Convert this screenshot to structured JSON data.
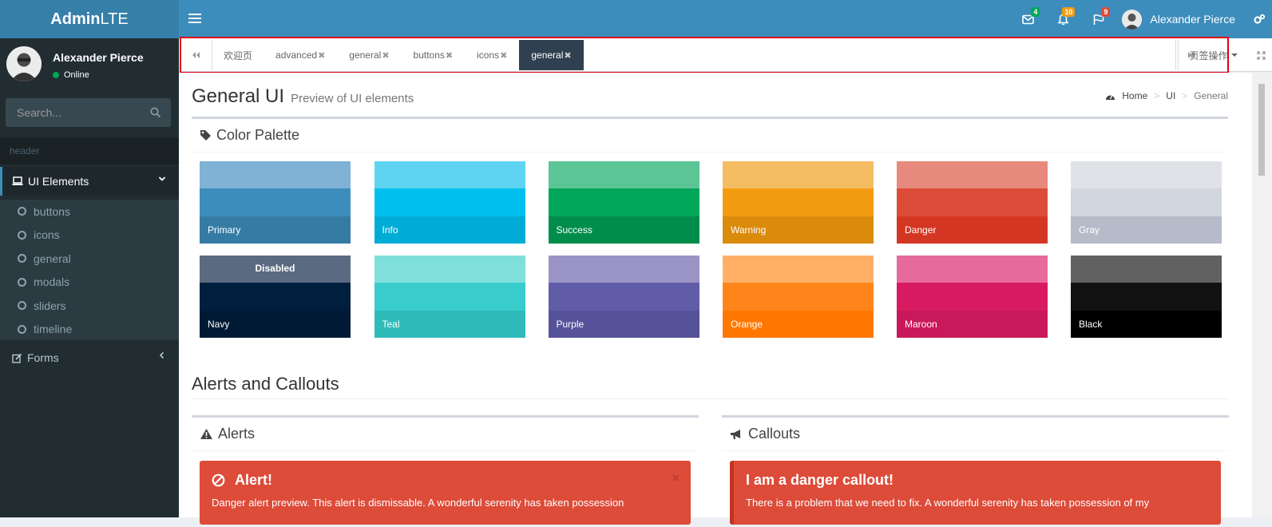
{
  "header": {
    "logo_bold": "Admin",
    "logo_rest": "LTE",
    "messages_count": "4",
    "notifications_count": "10",
    "tasks_count": "9",
    "user_name": "Alexander Pierce",
    "colors": {
      "header_bg": "#3c8dbc",
      "logo_bg": "#367fa9",
      "badge_green": "#00a65a",
      "badge_yellow": "#f39c12",
      "badge_red": "#dd4b39"
    }
  },
  "sidebar": {
    "user_name": "Alexander Pierce",
    "user_status": "Online",
    "search_placeholder": "Search...",
    "section_header": "header",
    "ui_elements_label": "UI Elements",
    "sub_items": [
      "buttons",
      "icons",
      "general",
      "modals",
      "sliders",
      "timeline"
    ],
    "forms_label": "Forms"
  },
  "tabbar": {
    "tabs": [
      {
        "label": "欢迎页",
        "closable": false
      },
      {
        "label": "advanced",
        "closable": true
      },
      {
        "label": "general",
        "closable": true
      },
      {
        "label": "buttons",
        "closable": true
      },
      {
        "label": "icons",
        "closable": true
      },
      {
        "label": "general",
        "closable": true,
        "active": true
      }
    ],
    "close_glyph": "✖",
    "ops_label": "页签操作"
  },
  "content": {
    "title": "General UI",
    "subtitle": "Preview of UI elements",
    "breadcrumb": {
      "home": "Home",
      "ui": "UI",
      "current": "General",
      "separator": ">"
    },
    "palette_title": "Color Palette",
    "palette": [
      {
        "name": "Primary",
        "colors": [
          "#7fb2d4",
          "#3c8dbc",
          "#357ca5"
        ]
      },
      {
        "name": "Info",
        "colors": [
          "#5fd4f2",
          "#00c0ef",
          "#00acd6"
        ]
      },
      {
        "name": "Success",
        "colors": [
          "#5bc595",
          "#00a65a",
          "#008d4c"
        ]
      },
      {
        "name": "Warning",
        "colors": [
          "#f5bd63",
          "#f39c12",
          "#db8b0b"
        ]
      },
      {
        "name": "Danger",
        "colors": [
          "#e7897d",
          "#dd4b39",
          "#d33724"
        ]
      },
      {
        "name": "Gray",
        "colors": [
          "#e0e2e7",
          "#d2d6de",
          "#b5bbc8"
        ]
      },
      {
        "name": "Navy",
        "colors": [
          "#5a6a80",
          "#001f3f",
          "#001a35"
        ],
        "disabled_label": "Disabled"
      },
      {
        "name": "Teal",
        "colors": [
          "#7fdfdb",
          "#39cccc",
          "#30bbbb"
        ]
      },
      {
        "name": "Purple",
        "colors": [
          "#9a93c5",
          "#605ca8",
          "#555299"
        ]
      },
      {
        "name": "Orange",
        "colors": [
          "#ffb066",
          "#ff851b",
          "#ff7701"
        ]
      },
      {
        "name": "Maroon",
        "colors": [
          "#e76a9d",
          "#d81b60",
          "#ca195a"
        ]
      },
      {
        "name": "Black",
        "colors": [
          "#616161",
          "#111111",
          "#000000"
        ]
      }
    ],
    "alerts_section_title": "Alerts and Callouts",
    "alerts_box_title": "Alerts",
    "alert_title": "Alert!",
    "alert_text": "Danger alert preview. This alert is dismissable. A wonderful serenity has taken possession",
    "alert_close": "×",
    "callouts_box_title": "Callouts",
    "callout_title": "I am a danger callout!",
    "callout_text": "There is a problem that we need to fix. A wonderful serenity has taken possession of my"
  }
}
